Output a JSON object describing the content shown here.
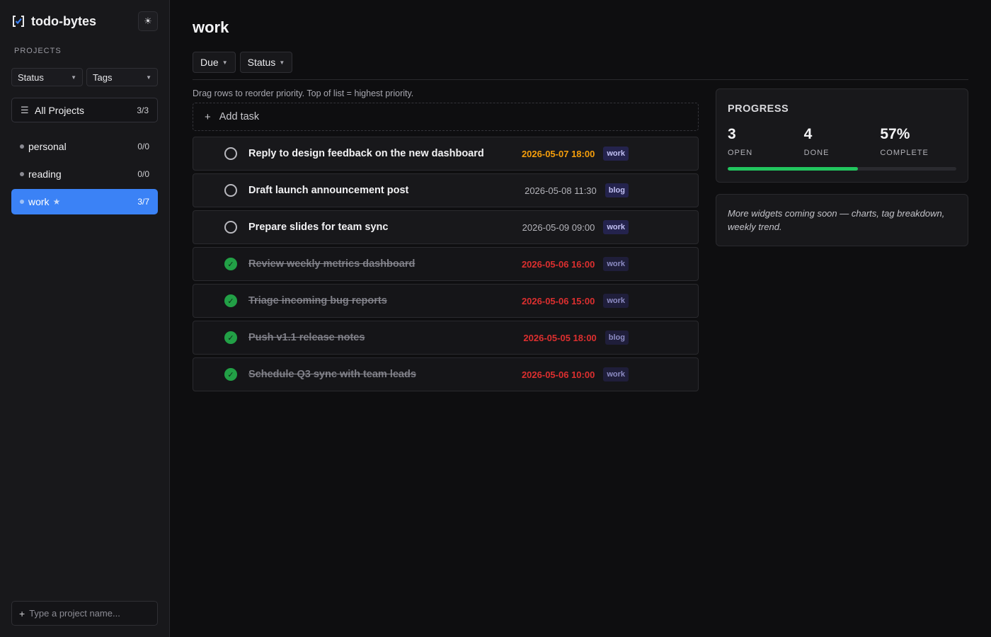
{
  "app": {
    "name": "todo-bytes",
    "theme_icon": "sun-icon"
  },
  "sidebar": {
    "section_label": "PROJECTS",
    "filters": [
      {
        "label": "Status"
      },
      {
        "label": "Tags"
      }
    ],
    "all_projects": {
      "label": "All Projects",
      "count": "3/3",
      "icon": "menu-icon"
    },
    "projects": [
      {
        "name": "personal",
        "count": "0/0",
        "active": false
      },
      {
        "name": "reading",
        "count": "0/0",
        "active": false
      },
      {
        "name": "work",
        "count": "3/7",
        "active": true,
        "starred": true,
        "star_icon": "★"
      }
    ],
    "new_project": {
      "placeholder": "Type a project name..."
    }
  },
  "main": {
    "title": "work",
    "toolbar": [
      {
        "label": "Due"
      },
      {
        "label": "Status"
      }
    ],
    "hint": "Drag rows to reorder priority. Top of list = highest priority.",
    "add_task_label": "Add task",
    "tasks": [
      {
        "title": "Reply to design feedback on the new dashboard",
        "due": "2026-05-07 18:00",
        "due_state": "soon",
        "tag": "work",
        "done": false
      },
      {
        "title": "Draft launch announcement post",
        "due": "2026-05-08 11:30",
        "due_state": "normal",
        "tag": "blog",
        "done": false
      },
      {
        "title": "Prepare slides for team sync",
        "due": "2026-05-09 09:00",
        "due_state": "normal",
        "tag": "work",
        "done": false
      },
      {
        "title": "Review weekly metrics dashboard",
        "due": "2026-05-06 16:00",
        "due_state": "overdue",
        "tag": "work",
        "done": true
      },
      {
        "title": "Triage incoming bug reports",
        "due": "2026-05-06 15:00",
        "due_state": "overdue",
        "tag": "work",
        "done": true
      },
      {
        "title": "Push v1.1 release notes",
        "due": "2026-05-05 18:00",
        "due_state": "overdue",
        "tag": "blog",
        "done": true
      },
      {
        "title": "Schedule Q3 sync with team leads",
        "due": "2026-05-06 10:00",
        "due_state": "overdue",
        "tag": "work",
        "done": true
      }
    ]
  },
  "progress": {
    "title": "PROGRESS",
    "stats": [
      {
        "value": "3",
        "label": "OPEN"
      },
      {
        "value": "4",
        "label": "DONE"
      },
      {
        "value": "57%",
        "label": "COMPLETE"
      }
    ],
    "fraction": 0.57
  },
  "note": {
    "text": "More widgets coming soon — charts, tag breakdown, weekly trend."
  },
  "colors": {
    "accent": "#3b82f6",
    "progress": "#22c55e",
    "due_soon": "#f59e0b",
    "overdue": "#dc2f2f",
    "done_check": "#22a046"
  }
}
